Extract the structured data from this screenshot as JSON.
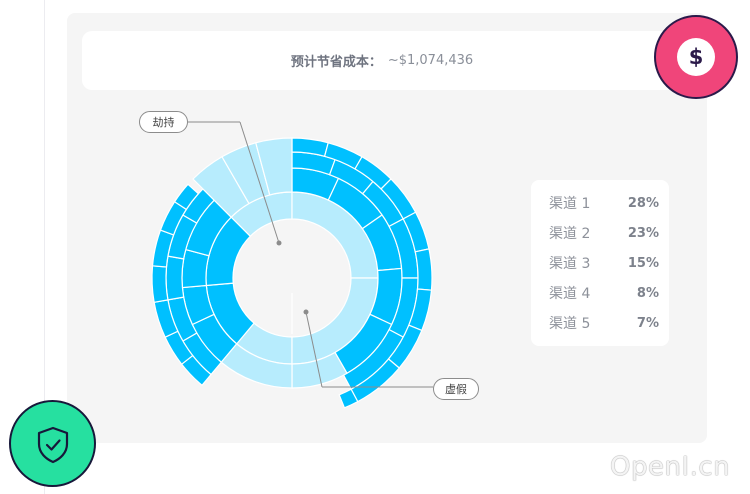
{
  "savings": {
    "label": "预计节省成本：",
    "value": "~$1,074,436"
  },
  "legend": {
    "items": [
      {
        "name": "渠道 1",
        "pct": "28%"
      },
      {
        "name": "渠道 2",
        "pct": "23%"
      },
      {
        "name": "渠道 3",
        "pct": "15%"
      },
      {
        "name": "渠道 4",
        "pct": "8%"
      },
      {
        "name": "渠道 5",
        "pct": "7%"
      }
    ]
  },
  "callouts": {
    "hijack": "劫持",
    "fake": "虚假"
  },
  "badges": {
    "dollar_symbol": "$",
    "dollar_icon": "dollar-icon",
    "shield_icon": "shield-check-icon"
  },
  "watermark": "OpenI.cn",
  "colors": {
    "accent_blue": "#00c0ff",
    "light_blue": "#b7ecfd",
    "pink": "#f0457a",
    "green": "#26e0a0",
    "navy": "#2b1a4a"
  }
}
